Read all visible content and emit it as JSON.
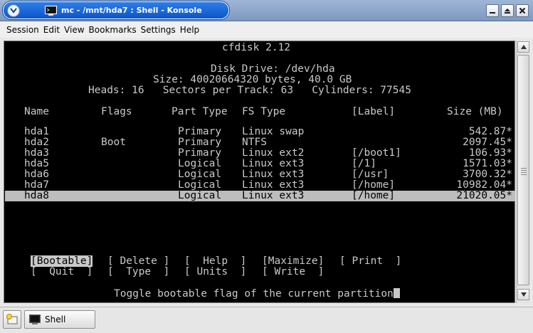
{
  "window": {
    "title": "mc - /mnt/hda7 : Shell - Konsole"
  },
  "menubar": {
    "items": [
      "Session",
      "Edit",
      "View",
      "Bookmarks",
      "Settings",
      "Help"
    ]
  },
  "terminal": {
    "program": "cfdisk 2.12",
    "disk_drive": "Disk Drive: /dev/hda",
    "size": "Size: 40020664320 bytes, 40.0 GB",
    "geometry": "Heads: 16   Sectors per Track: 63   Cylinders: 77545",
    "headers": {
      "name": "Name",
      "flags": "Flags",
      "part_type": "Part Type",
      "fs_type": "FS Type",
      "label": "[Label]",
      "size": "Size (MB)"
    },
    "partitions": [
      {
        "name": "hda1",
        "flags": "",
        "part_type": "Primary",
        "fs_type": "Linux swap",
        "label": "",
        "size": "542.87*"
      },
      {
        "name": "hda2",
        "flags": "Boot",
        "part_type": "Primary",
        "fs_type": "NTFS",
        "label": "",
        "size": "2097.45*"
      },
      {
        "name": "hda3",
        "flags": "",
        "part_type": "Primary",
        "fs_type": "Linux ext2",
        "label": "[/boot1]",
        "size": "106.93*"
      },
      {
        "name": "hda5",
        "flags": "",
        "part_type": "Logical",
        "fs_type": "Linux ext3",
        "label": "[/1]",
        "size": "1571.03*"
      },
      {
        "name": "hda6",
        "flags": "",
        "part_type": "Logical",
        "fs_type": "Linux ext3",
        "label": "[/usr]",
        "size": "3700.32*"
      },
      {
        "name": "hda7",
        "flags": "",
        "part_type": "Logical",
        "fs_type": "Linux ext3",
        "label": "[/home]",
        "size": "10982.04*"
      },
      {
        "name": "hda8",
        "flags": "",
        "part_type": "Logical",
        "fs_type": "Linux ext3",
        "label": "[/home]",
        "size": "21020.05*"
      }
    ],
    "selected_partition": "hda8",
    "buttons_row1": [
      "[Bootable]",
      "[ Delete ]",
      "[  Help  ]",
      "[Maximize]",
      "[ Print  ]"
    ],
    "buttons_row2": [
      "[  Quit  ]",
      "[  Type  ]",
      "[ Units  ]",
      "[ Write  ]"
    ],
    "selected_button": "[Bootable]",
    "status": "Toggle bootable flag of the current partition"
  },
  "taskbar": {
    "tab_label": "Shell"
  },
  "colors": {
    "title_active": "#0a56c9",
    "terminal_bg": "#000000",
    "terminal_fg": "#c9c9c9",
    "selection_bg": "#bdbdbd"
  }
}
